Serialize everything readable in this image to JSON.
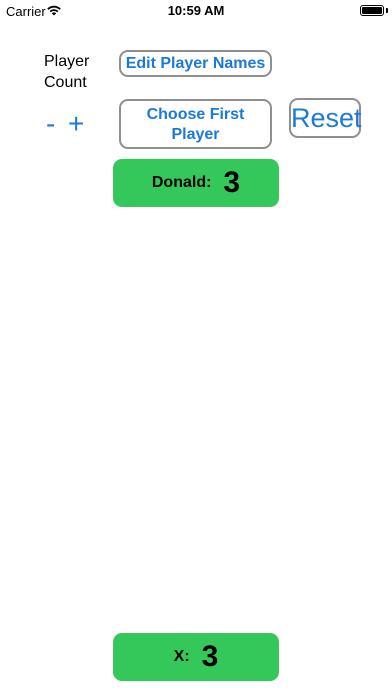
{
  "status_bar": {
    "carrier": "Carrier",
    "time": "10:59 AM"
  },
  "controls": {
    "player_count_label": "Player Count",
    "minus_label": "-",
    "plus_label": "+",
    "edit_names_label": "Edit Player Names",
    "choose_first_label": "Choose First Player",
    "reset_label": "Reset"
  },
  "players": [
    {
      "name": "Donald:",
      "score": "3"
    },
    {
      "name": "X:",
      "score": "3"
    }
  ],
  "colors": {
    "accent": "#1a7ad9",
    "card_green": "#34c759",
    "button_border": "#8e8e93"
  }
}
